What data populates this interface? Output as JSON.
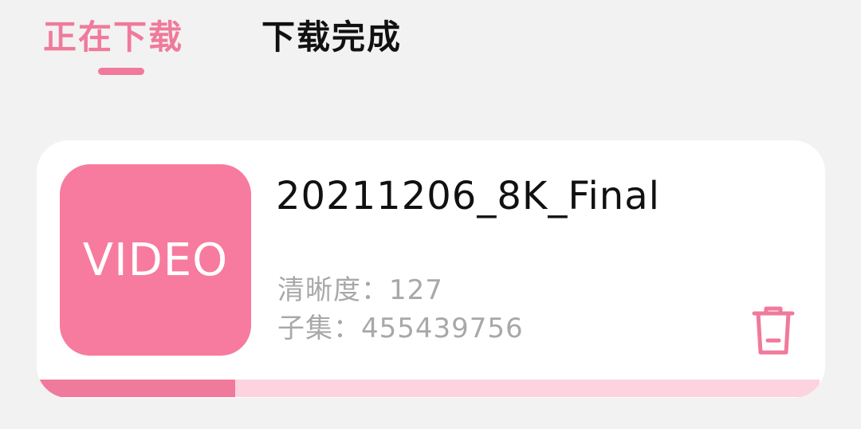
{
  "colors": {
    "accent": "#f07a9b",
    "thumb_bg": "#f77b9e",
    "progress_track": "#fdd3df",
    "progress_fill": "#f07a9b",
    "inactive_tab": "#111111"
  },
  "tabs": [
    {
      "label": "正在下载",
      "active": true
    },
    {
      "label": "下载完成",
      "active": false
    }
  ],
  "download_item": {
    "thumbnail_label": "VIDEO",
    "title": "20211206_8K_Final",
    "resolution_label": "清晰度：",
    "resolution_value": "127",
    "episode_label": "子集：",
    "episode_value": "455439756",
    "delete_icon": "trash-icon",
    "progress": 0.25
  }
}
